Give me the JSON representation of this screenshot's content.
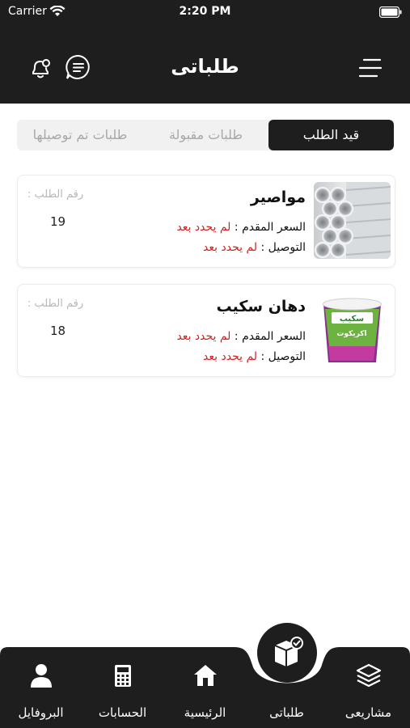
{
  "status_bar": {
    "carrier": "Carrier",
    "time": "2:20 PM"
  },
  "header": {
    "title": "طلباتى"
  },
  "tabs": [
    {
      "label": "قيد الطلب",
      "active": true
    },
    {
      "label": "طلبات مقبولة",
      "active": false
    },
    {
      "label": "طلبات تم توصيلها",
      "active": false
    }
  ],
  "orders": [
    {
      "name": "مواصير",
      "price_label": "السعر المقدم :",
      "price_value": "لم يحدد بعد",
      "delivery_label": "التوصيل :",
      "delivery_value": "لم يحدد بعد",
      "order_label": "رقم الطلب :",
      "order_number": "19",
      "image": "steel-pipes"
    },
    {
      "name": "دهان سكيب",
      "price_label": "السعر المقدم :",
      "price_value": "لم يحدد بعد",
      "delivery_label": "التوصيل :",
      "delivery_value": "لم يحدد بعد",
      "order_label": "رقم الطلب :",
      "order_number": "18",
      "image": "paint-bucket",
      "image_text_top": "سكيب",
      "image_text_mid": "اكريكوت"
    }
  ],
  "bottom_nav": [
    {
      "label": "مشاريعى",
      "icon": "layers-icon"
    },
    {
      "label": "طلباتى",
      "icon": "box-check-icon",
      "active": true
    },
    {
      "label": "الرئيسية",
      "icon": "home-icon"
    },
    {
      "label": "الحسابات",
      "icon": "calculator-icon"
    },
    {
      "label": "البروفايل",
      "icon": "user-icon"
    }
  ],
  "colors": {
    "dark": "#1e1e1e",
    "accent_red": "#d21f1f",
    "muted": "#a8a8a8"
  }
}
